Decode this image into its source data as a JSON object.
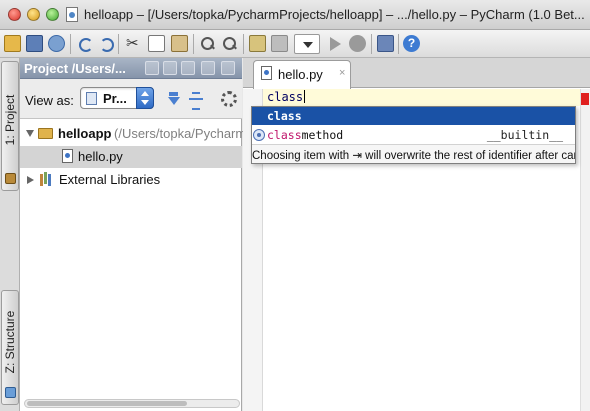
{
  "window": {
    "title": "helloapp – [/Users/topka/PycharmProjects/helloapp] – .../hello.py – PyCharm (1.0 Bet..."
  },
  "toolbar": {
    "icons": [
      "open-folder-icon",
      "save-icon",
      "synchronize-icon",
      "undo-icon",
      "redo-icon",
      "cut-icon",
      "copy-icon",
      "paste-icon",
      "find-icon",
      "replace-icon",
      "navigate-up-icon",
      "navigate-down-icon",
      "run-config-dropdown",
      "run-icon",
      "debug-icon",
      "settings-icon",
      "help-icon"
    ],
    "help_glyph": "?"
  },
  "tool_stripe": {
    "project_label": "1: Project",
    "structure_label": "Z: Structure"
  },
  "project_panel": {
    "header_title": "Project /Users/...",
    "view_as_label": "View as:",
    "view_as_value": "Pr...",
    "tree": [
      {
        "label": "helloapp",
        "path": "(/Users/topka/PycharmP",
        "expanded": true
      },
      {
        "label": "hello.py"
      },
      {
        "label": "External Libraries",
        "expanded": false
      }
    ]
  },
  "editor": {
    "tab_label": "hello.py",
    "tab_close": "×",
    "code_line": "class",
    "error_marker_color": "#e02020"
  },
  "completion": {
    "items": [
      {
        "match": "class",
        "rest": "",
        "type": ""
      },
      {
        "match": "class",
        "rest": "method",
        "type": "__builtin__"
      }
    ],
    "hint": "Choosing item with ⇥ will overwrite the rest of identifier after caret"
  }
}
